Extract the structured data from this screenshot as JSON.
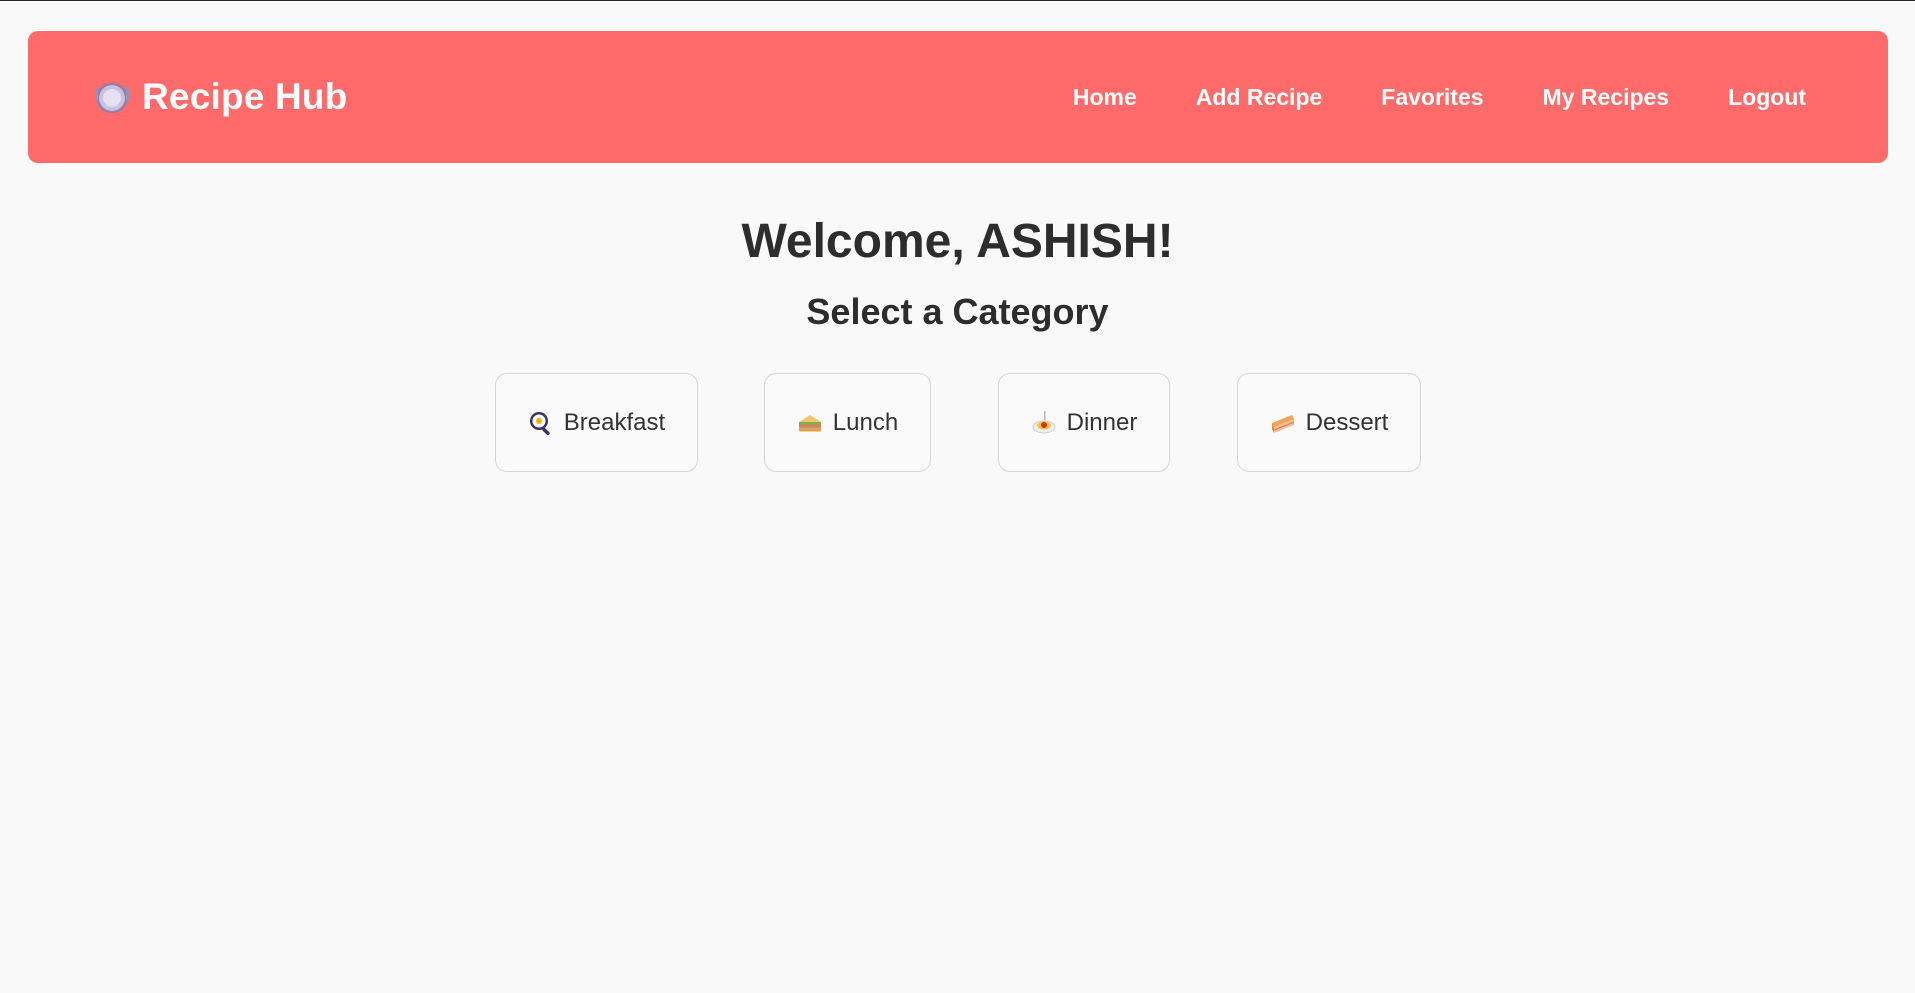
{
  "app": {
    "brand_title": "Recipe Hub",
    "brand_icon": "plate-icon"
  },
  "nav": {
    "items": [
      {
        "label": "Home"
      },
      {
        "label": "Add Recipe"
      },
      {
        "label": "Favorites"
      },
      {
        "label": "My Recipes"
      },
      {
        "label": "Logout"
      }
    ]
  },
  "main": {
    "welcome": "Welcome, ASHISH!",
    "subtitle": "Select a Category",
    "categories": [
      {
        "label": "Breakfast",
        "icon": "frying-pan-icon"
      },
      {
        "label": "Lunch",
        "icon": "sandwich-icon"
      },
      {
        "label": "Dinner",
        "icon": "spaghetti-icon"
      },
      {
        "label": "Dessert",
        "icon": "cake-slice-icon"
      }
    ]
  },
  "colors": {
    "navbar": "#ff6b6b",
    "background": "#f9f9f9",
    "text": "#2d2d2d",
    "nav_text": "#ffffff"
  }
}
